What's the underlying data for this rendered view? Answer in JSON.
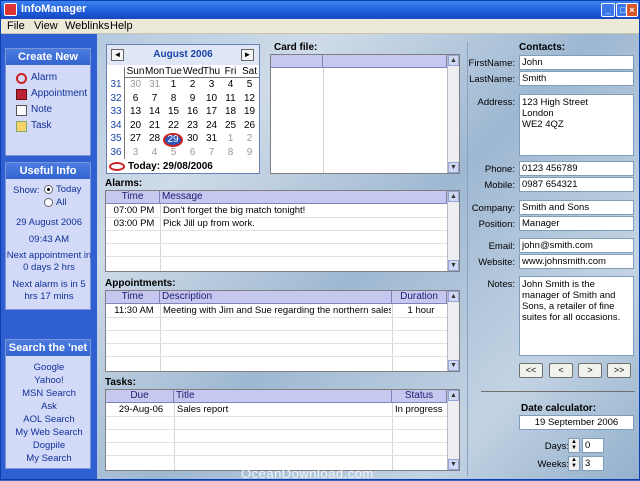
{
  "window": {
    "title": "InfoManager"
  },
  "menu": [
    "File",
    "View",
    "Weblinks",
    "Help"
  ],
  "create_new": {
    "title": "Create New",
    "items": [
      "Alarm",
      "Appointment",
      "Note",
      "Task"
    ]
  },
  "useful_info": {
    "title": "Useful Info",
    "show_label": "Show:",
    "options": [
      "Today",
      "All"
    ],
    "date": "29 August 2006",
    "time": "09:43 AM",
    "next_appt_line1": "Next appointment in",
    "next_appt_line2": "0 days 2 hrs",
    "next_alarm_line1": "Next alarm is in 5",
    "next_alarm_line2": "hrs 17 mins"
  },
  "search": {
    "title": "Search the 'net",
    "links": [
      "Google",
      "Yahoo!",
      "MSN Search",
      "Ask",
      "AOL Search",
      "My Web Search",
      "Dogpile",
      "My Search"
    ]
  },
  "calendar": {
    "month": "August 2006",
    "prev": "◄",
    "next": "►",
    "weekdays": [
      "Sun",
      "Mon",
      "Tue",
      "Wed",
      "Thu",
      "Fri",
      "Sat"
    ],
    "weeks": [
      {
        "wk": "31",
        "days": [
          "30",
          "31",
          "1",
          "2",
          "3",
          "4",
          "5"
        ]
      },
      {
        "wk": "32",
        "days": [
          "6",
          "7",
          "8",
          "9",
          "10",
          "11",
          "12"
        ]
      },
      {
        "wk": "33",
        "days": [
          "13",
          "14",
          "15",
          "16",
          "17",
          "18",
          "19"
        ]
      },
      {
        "wk": "34",
        "days": [
          "20",
          "21",
          "22",
          "23",
          "24",
          "25",
          "26"
        ]
      },
      {
        "wk": "35",
        "days": [
          "27",
          "28",
          "29",
          "30",
          "31",
          "1",
          "2"
        ]
      },
      {
        "wk": "36",
        "days": [
          "3",
          "4",
          "5",
          "6",
          "7",
          "8",
          "9"
        ]
      }
    ],
    "today_text": "Today: 29/08/2006"
  },
  "card_file": {
    "label": "Card file:"
  },
  "alarms": {
    "label": "Alarms:",
    "columns": [
      "Time",
      "Message"
    ],
    "rows": [
      [
        "07:00 PM",
        "Don't forget the big match tonight!"
      ],
      [
        "03:00 PM",
        "Pick Jill up from work."
      ]
    ]
  },
  "appointments": {
    "label": "Appointments:",
    "columns": [
      "Time",
      "Description",
      "Duration"
    ],
    "rows": [
      [
        "11:30 AM",
        "Meeting with Jim and Sue regarding the northern sales figur",
        "1 hour"
      ]
    ]
  },
  "tasks": {
    "label": "Tasks:",
    "columns": [
      "Due",
      "Title",
      "Status"
    ],
    "rows": [
      [
        "29-Aug-06",
        "Sales report",
        "In progress"
      ]
    ]
  },
  "contacts": {
    "label": "Contacts:",
    "firstname_label": "FirstName:",
    "firstname": "John",
    "lastname_label": "LastName:",
    "lastname": "Smith",
    "address_label": "Address:",
    "address": [
      "123 High Street",
      "London",
      "WE2 4QZ"
    ],
    "phone_label": "Phone:",
    "phone": "0123 456789",
    "mobile_label": "Mobile:",
    "mobile": "0987 654321",
    "company_label": "Company:",
    "company": "Smith and Sons",
    "position_label": "Position:",
    "position": "Manager",
    "email_label": "Email:",
    "email": "john@smith.com",
    "website_label": "Website:",
    "website": "www.johnsmith.com",
    "notes_label": "Notes:",
    "notes": "John Smith is the manager of Smith and Sons, a retailer of fine suites for all occasions.",
    "nav": [
      "<<",
      "<",
      ">",
      ">>"
    ]
  },
  "date_calc": {
    "label": "Date calculator:",
    "date": "19 September 2006",
    "days_label": "Days:",
    "days": "0",
    "weeks_label": "Weeks:",
    "weeks": "3"
  },
  "watermark": "OceanDownload.com"
}
